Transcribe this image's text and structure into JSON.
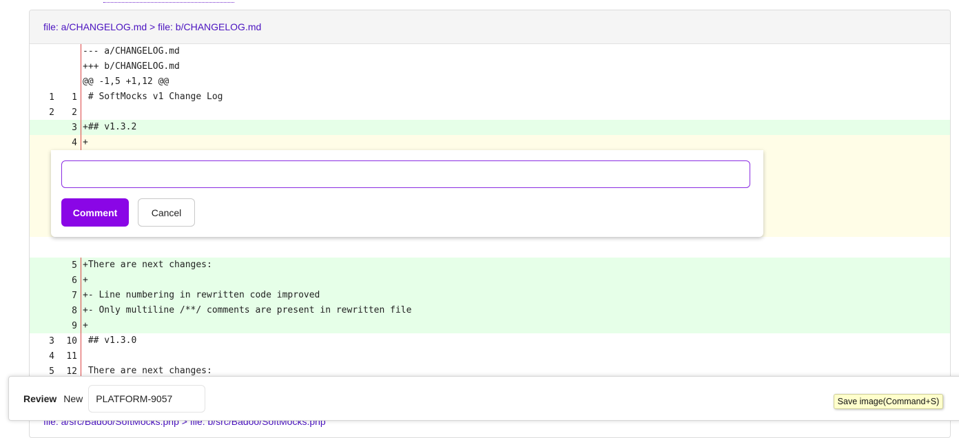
{
  "diff": {
    "header": {
      "old_file": "file: a/CHANGELOG.md",
      "separator": " > ",
      "new_file": "file: b/CHANGELOG.md"
    },
    "lines_top": [
      {
        "old": "",
        "new": "",
        "code": "--- a/CHANGELOG.md",
        "kind": "meta"
      },
      {
        "old": "",
        "new": "",
        "code": "+++ b/CHANGELOG.md",
        "kind": "meta"
      },
      {
        "old": "",
        "new": "",
        "code": "@@ -1,5 +1,12 @@",
        "kind": "meta"
      },
      {
        "old": "1",
        "new": "1",
        "code": " # SoftMocks v1 Change Log",
        "kind": "context"
      },
      {
        "old": "2",
        "new": "2",
        "code": "",
        "kind": "context"
      },
      {
        "old": "",
        "new": "3",
        "code": "+## v1.3.2",
        "kind": "added"
      },
      {
        "old": "",
        "new": "4",
        "code": "+",
        "kind": "draft"
      }
    ],
    "lines_bottom": [
      {
        "old": "",
        "new": "5",
        "code": "+There are next changes:",
        "kind": "added"
      },
      {
        "old": "",
        "new": "6",
        "code": "+",
        "kind": "added"
      },
      {
        "old": "",
        "new": "7",
        "code": "+- Line numbering in rewritten code improved",
        "kind": "added"
      },
      {
        "old": "",
        "new": "8",
        "code": "+- Only multiline /**/ comments are present in rewritten file",
        "kind": "added"
      },
      {
        "old": "",
        "new": "9",
        "code": "+",
        "kind": "added"
      },
      {
        "old": "3",
        "new": "10",
        "code": " ## v1.3.0",
        "kind": "context"
      },
      {
        "old": "4",
        "new": "11",
        "code": "",
        "kind": "context"
      },
      {
        "old": "5",
        "new": "12",
        "code": " There are next changes:",
        "kind": "context"
      }
    ]
  },
  "comment_form": {
    "input_value": "",
    "comment_label": "Comment",
    "cancel_label": "Cancel"
  },
  "review_bar": {
    "title": "Review",
    "status": "New",
    "ticket_value": "PLATFORM-9057"
  },
  "tooltip": {
    "save_image": "Save image(Command+S)"
  },
  "next_file": {
    "label": "file: a/src/Badoo/SoftMocks.php > file: b/src/Badoo/SoftMocks.php"
  },
  "colors": {
    "link": "#4a12c0",
    "added_bg": "#e6ffe8",
    "draft_bg": "#fffde7",
    "primary_button": "#8a06e6",
    "focus_border": "#8a2be2"
  }
}
